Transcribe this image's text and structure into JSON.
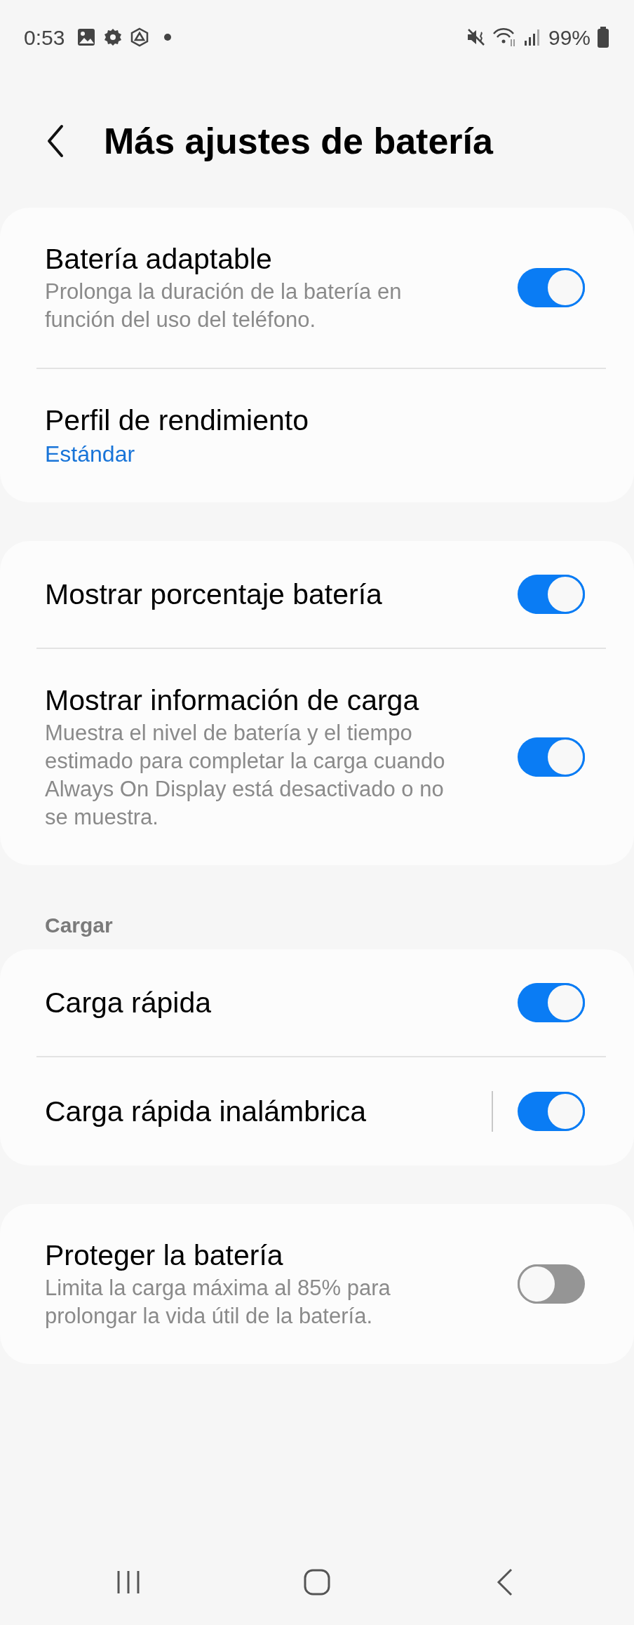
{
  "status_bar": {
    "time": "0:53",
    "battery": "99%"
  },
  "header": {
    "title": "Más ajustes de batería"
  },
  "groups": [
    {
      "items": [
        {
          "kind": "toggle",
          "title": "Batería adaptable",
          "subtitle": "Prolonga la duración de la batería en función del uso del teléfono.",
          "on": true
        },
        {
          "kind": "link",
          "title": "Perfil de rendimiento",
          "value": "Estándar"
        }
      ]
    },
    {
      "items": [
        {
          "kind": "toggle",
          "title": "Mostrar porcentaje batería",
          "on": true
        },
        {
          "kind": "toggle",
          "title": "Mostrar información de carga",
          "subtitle": "Muestra el nivel de batería y el tiempo estimado para completar la carga cuando Always On Display está desactivado o no se muestra.",
          "on": true
        }
      ]
    },
    {
      "header": "Cargar",
      "items": [
        {
          "kind": "toggle",
          "title": "Carga rápida",
          "on": true
        },
        {
          "kind": "toggle",
          "title": "Carga rápida inalámbrica",
          "on": true,
          "split": true
        }
      ]
    },
    {
      "items": [
        {
          "kind": "toggle",
          "title": "Proteger la batería",
          "subtitle": "Limita la carga máxima al 85% para prolongar la vida útil de la batería.",
          "on": false
        }
      ]
    }
  ]
}
